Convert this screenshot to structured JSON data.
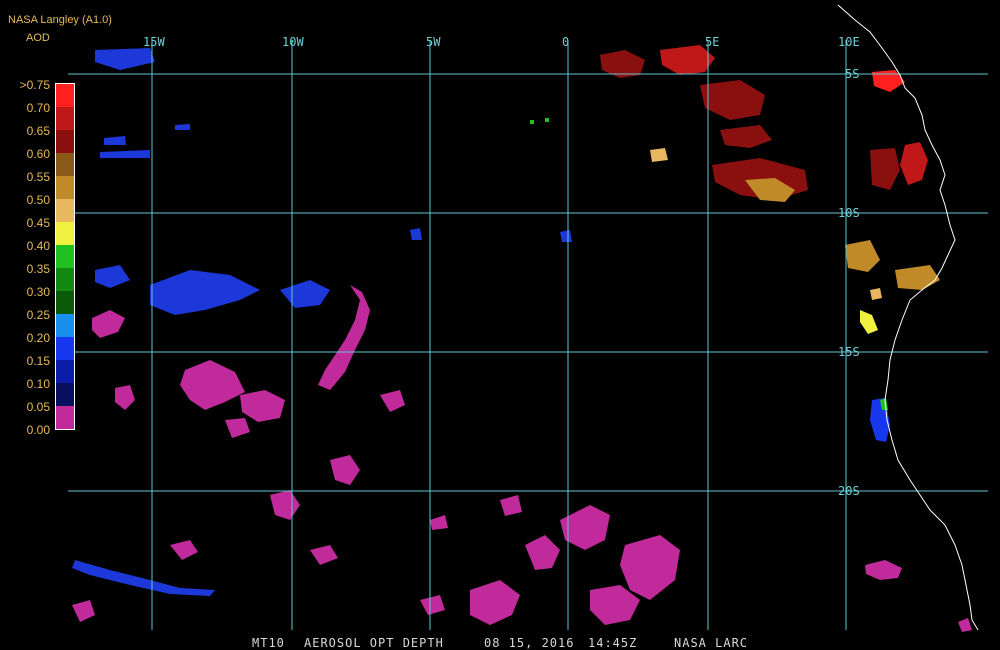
{
  "header": {
    "source": "NASA Langley (A1.0)",
    "variable": "AOD"
  },
  "colors": {
    "grid": "#5fc8d0",
    "coast": "#ffffff",
    "label_text": "#e8b85a"
  },
  "longitude_labels": [
    "15W",
    "10W",
    "5W",
    "0",
    "5E",
    "10E"
  ],
  "latitude_labels": [
    "5S",
    "10S",
    "15S",
    "20S"
  ],
  "color_scale": {
    "labels": [
      ">0.75",
      "0.70",
      "0.65",
      "0.60",
      "0.55",
      "0.50",
      "0.45",
      "0.40",
      "0.35",
      "0.30",
      "0.25",
      "0.20",
      "0.15",
      "0.10",
      "0.05",
      "0.00"
    ],
    "colors": [
      "#ff2020",
      "#c01818",
      "#8a1010",
      "#8a5a18",
      "#c08a28",
      "#e8b860",
      "#f0f040",
      "#20c020",
      "#128a12",
      "#0a5a0a",
      "#1890f0",
      "#1838f0",
      "#0a1ca8",
      "#0a1060",
      "#c02a9a"
    ]
  },
  "footer": {
    "product": "MT10",
    "parameter": "AEROSOL OPT DEPTH",
    "date": "08 15, 2016",
    "time": "14:45Z",
    "agency": "NASA LARC"
  }
}
